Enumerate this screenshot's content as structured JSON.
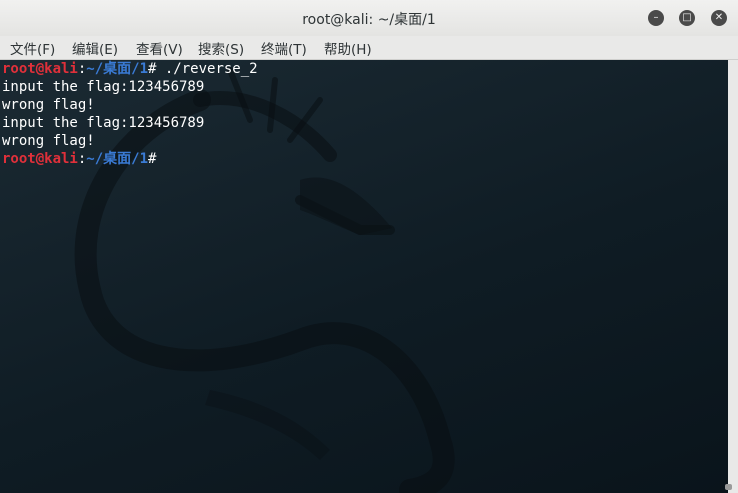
{
  "window": {
    "title": "root@kali: ~/桌面/1"
  },
  "controls": {
    "minimize": "–",
    "maximize": "□",
    "close": "✕"
  },
  "menu": [
    "文件(F)",
    "编辑(E)",
    "查看(V)",
    "搜索(S)",
    "终端(T)",
    "帮助(H)"
  ],
  "terminal": {
    "prompt": {
      "user": "root@kali",
      "sep": ":",
      "path": "~/桌面/1",
      "symbol": "#"
    },
    "lines": [
      {
        "type": "prompt",
        "cmd": " ./reverse_2"
      },
      {
        "type": "output",
        "text": "input the flag:123456789"
      },
      {
        "type": "output",
        "text": "wrong flag!"
      },
      {
        "type": "output",
        "text": "input the flag:123456789"
      },
      {
        "type": "output",
        "text": "wrong flag!"
      },
      {
        "type": "prompt",
        "cmd": ""
      }
    ]
  },
  "colors": {
    "prompt_user": "#e0303a",
    "prompt_path": "#3a7bd5",
    "background": "#0f1c24"
  }
}
